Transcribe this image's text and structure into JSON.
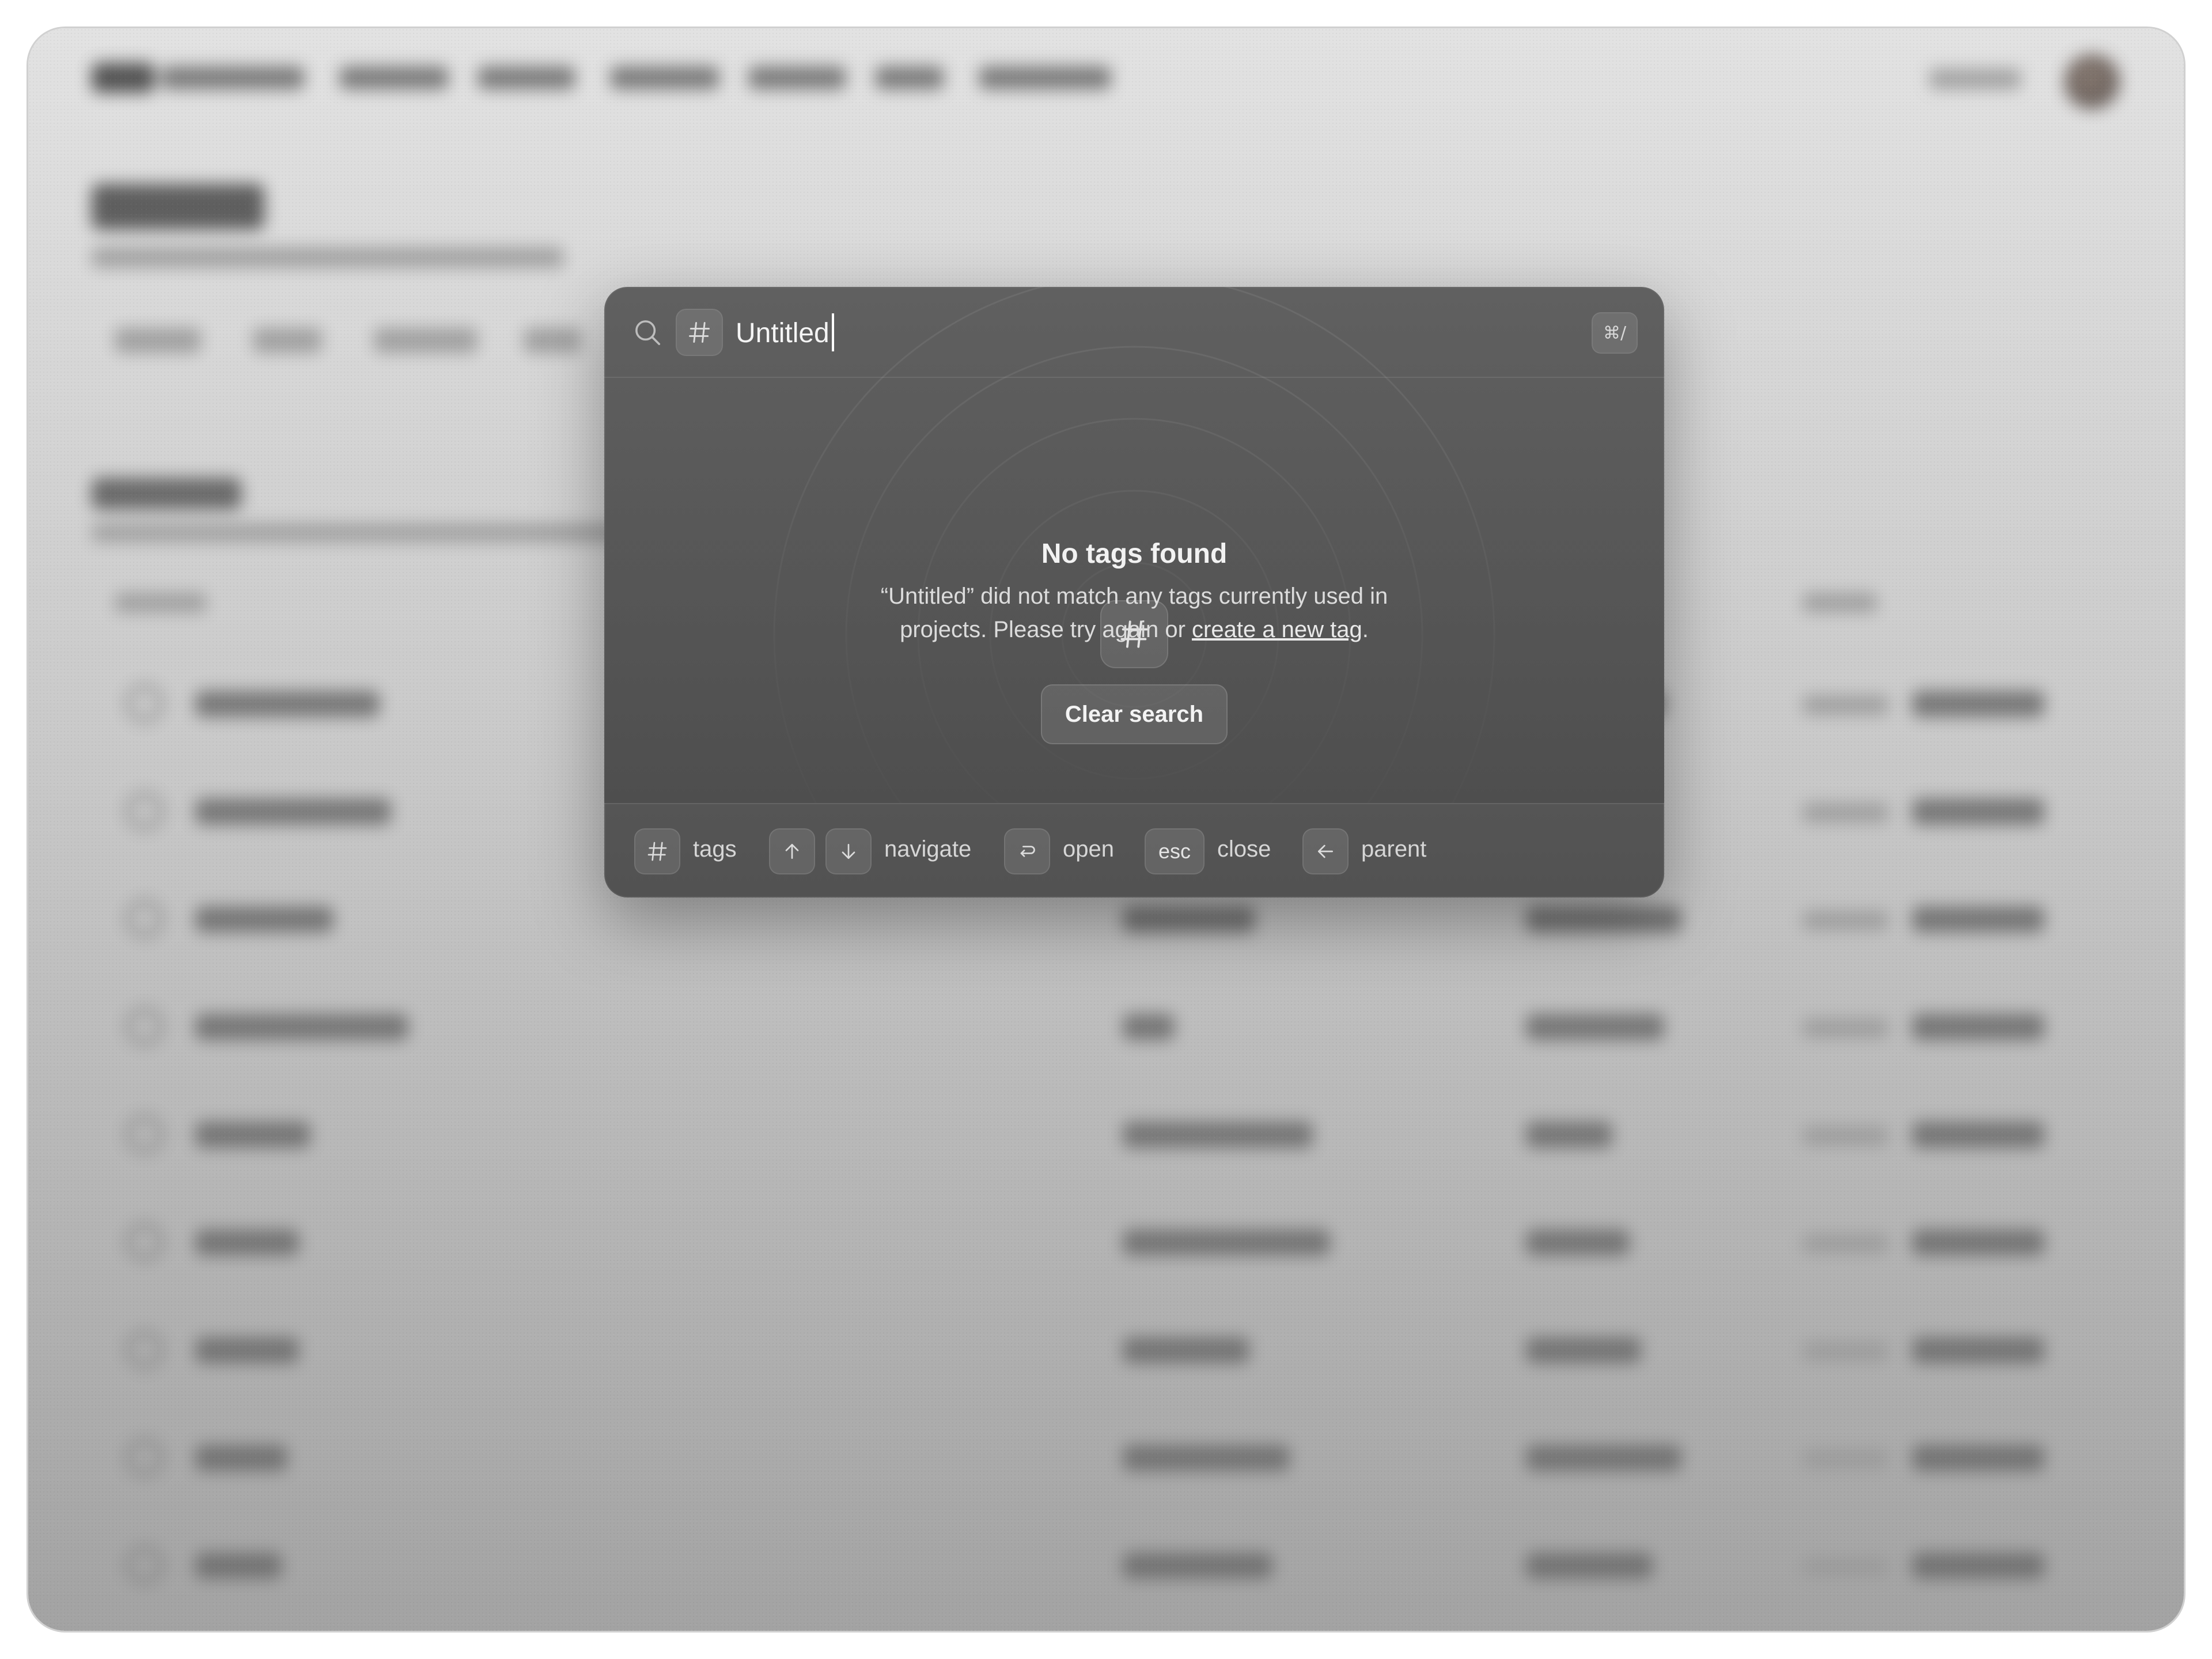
{
  "search": {
    "query": "Untitled",
    "placeholder": "",
    "shortcut_label": "⌘/"
  },
  "empty_state": {
    "title": "No tags found",
    "description_before": "“Untitled” did not match any tags currently used in projects. Please try again or ",
    "link_text": "create a new tag",
    "description_after": ".",
    "clear_button_label": "Clear search"
  },
  "footer": {
    "hints": [
      {
        "label": "tags"
      },
      {
        "label": "navigate"
      },
      {
        "label": "open"
      },
      {
        "key": "esc",
        "label": "close"
      },
      {
        "label": "parent"
      }
    ]
  },
  "icons": {
    "search": "search-icon",
    "hash": "hash-icon",
    "arrow_up": "arrow-up-icon",
    "arrow_down": "arrow-down-icon",
    "enter": "enter-icon",
    "arrow_left": "arrow-left-icon"
  }
}
